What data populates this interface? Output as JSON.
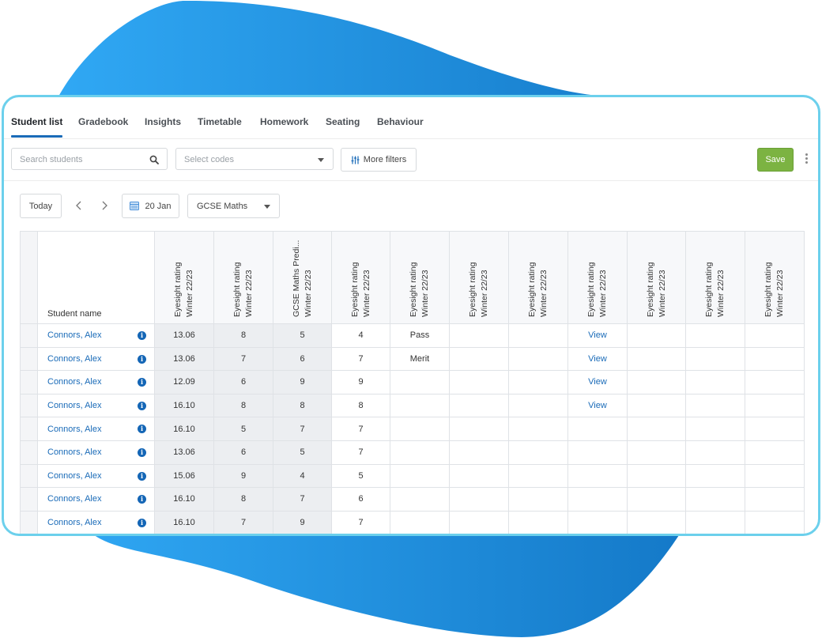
{
  "tabs": [
    {
      "label": "Student list",
      "active": true
    },
    {
      "label": "Gradebook",
      "active": false
    },
    {
      "label": "Insights",
      "active": false
    },
    {
      "label": "Timetable",
      "active": false
    },
    {
      "label": "Homework",
      "active": false
    },
    {
      "label": "Seating",
      "active": false
    },
    {
      "label": "Behaviour",
      "active": false
    }
  ],
  "toolbar": {
    "search_placeholder": "Search students",
    "codes_placeholder": "Select codes",
    "more_filters_label": "More filters",
    "save_label": "Save"
  },
  "datebar": {
    "today_label": "Today",
    "date_label": "20 Jan",
    "subject_label": "GCSE Maths"
  },
  "colors": {
    "accent": "#1a6bb8",
    "save": "#7cb342",
    "card_border": "#6cd0ec",
    "blob_start": "#30a8f4",
    "blob_end": "#1479c8"
  },
  "table": {
    "name_header": "Student name",
    "columns": [
      {
        "line1": "Eyesight rating",
        "line2": "Winter 22/23"
      },
      {
        "line1": "Eyesight rating",
        "line2": "Winter 22/23"
      },
      {
        "line1": "GCSE Maths Predi...",
        "line2": "Winter 22/23"
      },
      {
        "line1": "Eyesight rating",
        "line2": "Winter 22/23"
      },
      {
        "line1": "Eyesight rating",
        "line2": "Winter 22/23"
      },
      {
        "line1": "Eyesight rating",
        "line2": "Winter 22/23"
      },
      {
        "line1": "Eyesight rating",
        "line2": "Winter 22/23"
      },
      {
        "line1": "Eyesight rating",
        "line2": "Winter 22/23"
      },
      {
        "line1": "Eyesight rating",
        "line2": "Winter 22/23"
      },
      {
        "line1": "Eyesight rating",
        "line2": "Winter 22/23"
      },
      {
        "line1": "Eyesight rating",
        "line2": "Winter 22/23"
      }
    ],
    "rows": [
      {
        "name": "Connors, Alex",
        "cells": [
          "13.06",
          "8",
          "5",
          "4",
          "Pass",
          "",
          "",
          "View",
          "",
          "",
          ""
        ]
      },
      {
        "name": "Connors, Alex",
        "cells": [
          "13.06",
          "7",
          "6",
          "7",
          "Merit",
          "",
          "",
          "View",
          "",
          "",
          ""
        ]
      },
      {
        "name": "Connors, Alex",
        "cells": [
          "12.09",
          "6",
          "9",
          "9",
          "",
          "",
          "",
          "View",
          "",
          "",
          ""
        ]
      },
      {
        "name": "Connors, Alex",
        "cells": [
          "16.10",
          "8",
          "8",
          "8",
          "",
          "",
          "",
          "View",
          "",
          "",
          ""
        ]
      },
      {
        "name": "Connors, Alex",
        "cells": [
          "16.10",
          "5",
          "7",
          "7",
          "",
          "",
          "",
          "",
          "",
          "",
          ""
        ]
      },
      {
        "name": "Connors, Alex",
        "cells": [
          "13.06",
          "6",
          "5",
          "7",
          "",
          "",
          "",
          "",
          "",
          "",
          ""
        ]
      },
      {
        "name": "Connors, Alex",
        "cells": [
          "15.06",
          "9",
          "4",
          "5",
          "",
          "",
          "",
          "",
          "",
          "",
          ""
        ]
      },
      {
        "name": "Connors, Alex",
        "cells": [
          "16.10",
          "8",
          "7",
          "6",
          "",
          "",
          "",
          "",
          "",
          "",
          ""
        ]
      },
      {
        "name": "Connors, Alex",
        "cells": [
          "16.10",
          "7",
          "9",
          "7",
          "",
          "",
          "",
          "",
          "",
          "",
          ""
        ]
      }
    ]
  }
}
